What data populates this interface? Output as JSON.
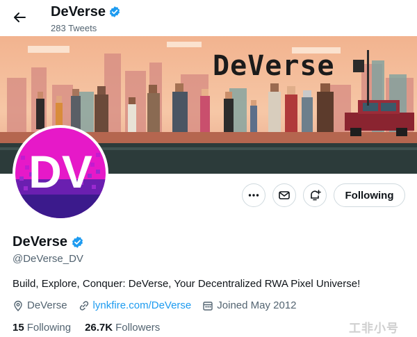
{
  "header": {
    "name": "DeVerse",
    "tweet_count": "283 Tweets"
  },
  "banner": {
    "logo_text": "DeVerse"
  },
  "avatar": {
    "letters": "DV"
  },
  "actions": {
    "following_label": "Following"
  },
  "profile": {
    "name": "DeVerse",
    "handle": "@DeVerse_DV",
    "bio": "Build, Explore, Conquer: DeVerse, Your Decentralized RWA Pixel Universe!",
    "location": "DeVerse",
    "website": "lynkfire.com/DeVerse",
    "joined": "Joined May 2012"
  },
  "stats": {
    "following_count": "15",
    "following_label": "Following",
    "followers_count": "26.7K",
    "followers_label": "Followers"
  },
  "watermark": "工非小号",
  "colors": {
    "verified": "#1d9bf0",
    "link": "#1d9bf0",
    "secondary_text": "#536471",
    "avatar_pink": "#e619c8",
    "avatar_purple": "#3b1a8c"
  }
}
